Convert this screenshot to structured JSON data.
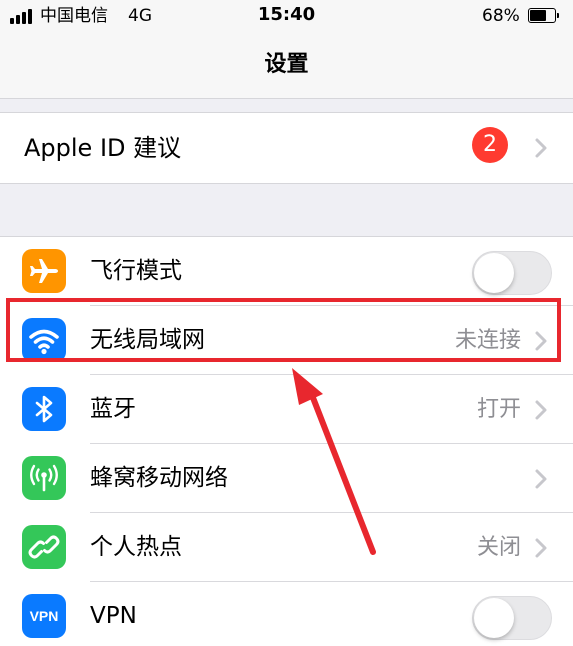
{
  "status_bar": {
    "carrier": "中国电信",
    "network": "4G",
    "time": "15:40",
    "battery_percent": "68%",
    "battery_level": 0.68
  },
  "nav": {
    "title": "设置"
  },
  "apple_id": {
    "label": "Apple ID 建议",
    "badge": "2"
  },
  "settings": [
    {
      "label": "飞行模式",
      "value": "",
      "icon": "airplane-icon",
      "toggle_on": false
    },
    {
      "label": "无线局域网",
      "value": "未连接",
      "icon": "wifi-icon"
    },
    {
      "label": "蓝牙",
      "value": "打开",
      "icon": "bluetooth-icon"
    },
    {
      "label": "蜂窝移动网络",
      "value": "",
      "icon": "cellular-icon"
    },
    {
      "label": "个人热点",
      "value": "关闭",
      "icon": "hotspot-icon"
    },
    {
      "label": "VPN",
      "value": "",
      "icon": "vpn-icon",
      "icon_text": "VPN"
    }
  ],
  "colors": {
    "background": "#efeff4",
    "airplane": "#ff9500",
    "blue": "#0a7aff",
    "green": "#34c759",
    "badge": "#ff3b30",
    "highlight": "#e8272e"
  }
}
